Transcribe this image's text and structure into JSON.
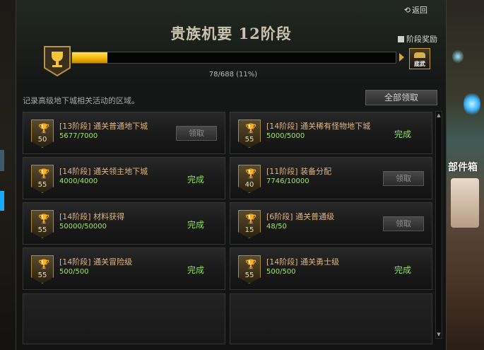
{
  "window": {
    "title": "贵族机要 12阶段",
    "back_label": "返回",
    "stage_reward_label": "阶段奖励",
    "chest_label": "底武",
    "progress": {
      "current": 78,
      "total": 688,
      "text": "78/688 (11%)",
      "percent": 11
    },
    "description": "记录高级地下城相关活动的区域。",
    "claim_all_label": "全部领取"
  },
  "quests": [
    {
      "level": "50",
      "title": "[13阶段] 通关普通地下城",
      "value": "5677/7000",
      "status": "claim",
      "status_label": "领取"
    },
    {
      "level": "55",
      "title": "[14阶段] 通关稀有怪物地下城",
      "value": "5000/5000",
      "status": "done",
      "status_label": "完成"
    },
    {
      "level": "55",
      "title": "[14阶段] 通关领主地下城",
      "value": "4000/4000",
      "status": "done",
      "status_label": "完成"
    },
    {
      "level": "40",
      "title": "[11阶段] 装备分配",
      "value": "7746/10000",
      "status": "claim",
      "status_label": "领取"
    },
    {
      "level": "55",
      "title": "[14阶段] 材料获得",
      "value": "50000/50000",
      "status": "done",
      "status_label": "完成"
    },
    {
      "level": "15",
      "title": "[6阶段] 通关普通级",
      "value": "48/50",
      "status": "claim",
      "status_label": "领取"
    },
    {
      "level": "55",
      "title": "[14阶段] 通关冒险级",
      "value": "500/500",
      "status": "done",
      "status_label": "完成"
    },
    {
      "level": "55",
      "title": "[14阶段] 通关勇士级",
      "value": "500/500",
      "status": "done",
      "status_label": "完成"
    }
  ],
  "background": {
    "right_text": "部件箱"
  },
  "colors": {
    "accent": "#f2b300",
    "done": "#8de05a",
    "value": "#a6e06a",
    "title": "#e0b67e"
  }
}
